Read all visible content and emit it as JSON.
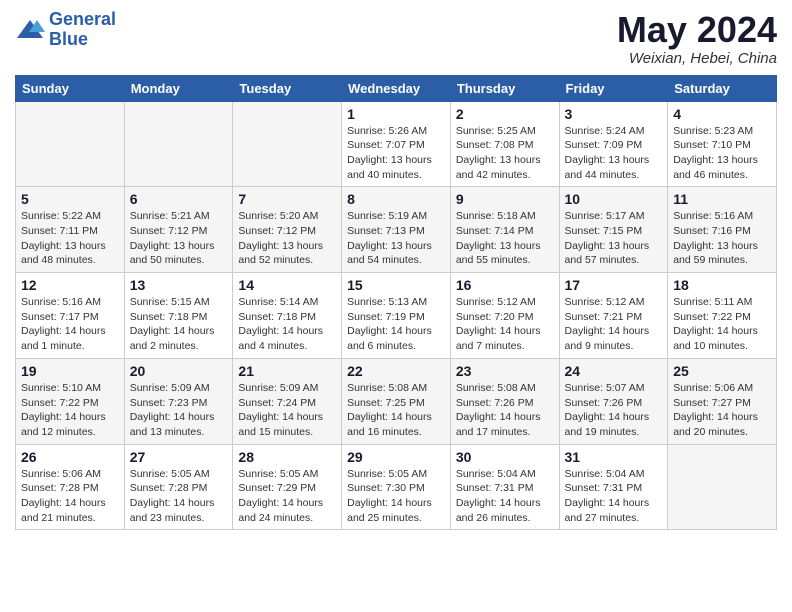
{
  "header": {
    "logo_line1": "General",
    "logo_line2": "Blue",
    "month": "May 2024",
    "location": "Weixian, Hebei, China"
  },
  "weekdays": [
    "Sunday",
    "Monday",
    "Tuesday",
    "Wednesday",
    "Thursday",
    "Friday",
    "Saturday"
  ],
  "weeks": [
    [
      {
        "day": "",
        "info": ""
      },
      {
        "day": "",
        "info": ""
      },
      {
        "day": "",
        "info": ""
      },
      {
        "day": "1",
        "info": "Sunrise: 5:26 AM\nSunset: 7:07 PM\nDaylight: 13 hours\nand 40 minutes."
      },
      {
        "day": "2",
        "info": "Sunrise: 5:25 AM\nSunset: 7:08 PM\nDaylight: 13 hours\nand 42 minutes."
      },
      {
        "day": "3",
        "info": "Sunrise: 5:24 AM\nSunset: 7:09 PM\nDaylight: 13 hours\nand 44 minutes."
      },
      {
        "day": "4",
        "info": "Sunrise: 5:23 AM\nSunset: 7:10 PM\nDaylight: 13 hours\nand 46 minutes."
      }
    ],
    [
      {
        "day": "5",
        "info": "Sunrise: 5:22 AM\nSunset: 7:11 PM\nDaylight: 13 hours\nand 48 minutes."
      },
      {
        "day": "6",
        "info": "Sunrise: 5:21 AM\nSunset: 7:12 PM\nDaylight: 13 hours\nand 50 minutes."
      },
      {
        "day": "7",
        "info": "Sunrise: 5:20 AM\nSunset: 7:12 PM\nDaylight: 13 hours\nand 52 minutes."
      },
      {
        "day": "8",
        "info": "Sunrise: 5:19 AM\nSunset: 7:13 PM\nDaylight: 13 hours\nand 54 minutes."
      },
      {
        "day": "9",
        "info": "Sunrise: 5:18 AM\nSunset: 7:14 PM\nDaylight: 13 hours\nand 55 minutes."
      },
      {
        "day": "10",
        "info": "Sunrise: 5:17 AM\nSunset: 7:15 PM\nDaylight: 13 hours\nand 57 minutes."
      },
      {
        "day": "11",
        "info": "Sunrise: 5:16 AM\nSunset: 7:16 PM\nDaylight: 13 hours\nand 59 minutes."
      }
    ],
    [
      {
        "day": "12",
        "info": "Sunrise: 5:16 AM\nSunset: 7:17 PM\nDaylight: 14 hours\nand 1 minute."
      },
      {
        "day": "13",
        "info": "Sunrise: 5:15 AM\nSunset: 7:18 PM\nDaylight: 14 hours\nand 2 minutes."
      },
      {
        "day": "14",
        "info": "Sunrise: 5:14 AM\nSunset: 7:18 PM\nDaylight: 14 hours\nand 4 minutes."
      },
      {
        "day": "15",
        "info": "Sunrise: 5:13 AM\nSunset: 7:19 PM\nDaylight: 14 hours\nand 6 minutes."
      },
      {
        "day": "16",
        "info": "Sunrise: 5:12 AM\nSunset: 7:20 PM\nDaylight: 14 hours\nand 7 minutes."
      },
      {
        "day": "17",
        "info": "Sunrise: 5:12 AM\nSunset: 7:21 PM\nDaylight: 14 hours\nand 9 minutes."
      },
      {
        "day": "18",
        "info": "Sunrise: 5:11 AM\nSunset: 7:22 PM\nDaylight: 14 hours\nand 10 minutes."
      }
    ],
    [
      {
        "day": "19",
        "info": "Sunrise: 5:10 AM\nSunset: 7:22 PM\nDaylight: 14 hours\nand 12 minutes."
      },
      {
        "day": "20",
        "info": "Sunrise: 5:09 AM\nSunset: 7:23 PM\nDaylight: 14 hours\nand 13 minutes."
      },
      {
        "day": "21",
        "info": "Sunrise: 5:09 AM\nSunset: 7:24 PM\nDaylight: 14 hours\nand 15 minutes."
      },
      {
        "day": "22",
        "info": "Sunrise: 5:08 AM\nSunset: 7:25 PM\nDaylight: 14 hours\nand 16 minutes."
      },
      {
        "day": "23",
        "info": "Sunrise: 5:08 AM\nSunset: 7:26 PM\nDaylight: 14 hours\nand 17 minutes."
      },
      {
        "day": "24",
        "info": "Sunrise: 5:07 AM\nSunset: 7:26 PM\nDaylight: 14 hours\nand 19 minutes."
      },
      {
        "day": "25",
        "info": "Sunrise: 5:06 AM\nSunset: 7:27 PM\nDaylight: 14 hours\nand 20 minutes."
      }
    ],
    [
      {
        "day": "26",
        "info": "Sunrise: 5:06 AM\nSunset: 7:28 PM\nDaylight: 14 hours\nand 21 minutes."
      },
      {
        "day": "27",
        "info": "Sunrise: 5:05 AM\nSunset: 7:28 PM\nDaylight: 14 hours\nand 23 minutes."
      },
      {
        "day": "28",
        "info": "Sunrise: 5:05 AM\nSunset: 7:29 PM\nDaylight: 14 hours\nand 24 minutes."
      },
      {
        "day": "29",
        "info": "Sunrise: 5:05 AM\nSunset: 7:30 PM\nDaylight: 14 hours\nand 25 minutes."
      },
      {
        "day": "30",
        "info": "Sunrise: 5:04 AM\nSunset: 7:31 PM\nDaylight: 14 hours\nand 26 minutes."
      },
      {
        "day": "31",
        "info": "Sunrise: 5:04 AM\nSunset: 7:31 PM\nDaylight: 14 hours\nand 27 minutes."
      },
      {
        "day": "",
        "info": ""
      }
    ]
  ]
}
